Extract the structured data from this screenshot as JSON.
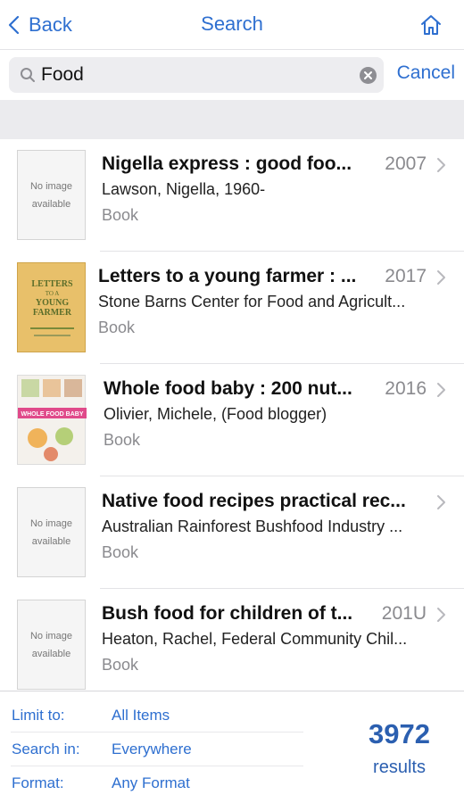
{
  "nav": {
    "back_label": "Back",
    "title": "Search",
    "home_icon": "home-icon"
  },
  "search": {
    "value": "Food",
    "placeholder": "",
    "cancel_label": "Cancel"
  },
  "results": [
    {
      "title": "Nigella express : good foo...",
      "year": "2007",
      "author": "Lawson, Nigella, 1960-",
      "format": "Book",
      "cover": "No image available"
    },
    {
      "title": "Letters to a young farmer : ...",
      "year": "2017",
      "author": "Stone Barns Center for Food and Agricult...",
      "format": "Book",
      "cover_lines": [
        "LETTERS",
        "TO A",
        "YOUNG",
        "FARMER"
      ]
    },
    {
      "title": "Whole food baby : 200 nut...",
      "year": "2016",
      "author": "Olivier, Michele, (Food blogger)",
      "format": "Book",
      "cover_text": "WHOLE FOOD BABY"
    },
    {
      "title": "Native food recipes practical rec...",
      "year": "",
      "author": "Australian Rainforest Bushfood Industry ...",
      "format": "Book",
      "cover": "No image available"
    },
    {
      "title": "Bush food for children of t...",
      "year": "201U",
      "author": "Heaton, Rachel, Federal Community Chil...",
      "format": "Book",
      "cover": "No image available"
    }
  ],
  "filters": {
    "limit_label": "Limit to:",
    "limit_value": "All Items",
    "search_in_label": "Search in:",
    "search_in_value": "Everywhere",
    "format_label": "Format:",
    "format_value": "Any Format"
  },
  "summary": {
    "count": "3972",
    "label": "results"
  },
  "colors": {
    "accent": "#2e6fd0",
    "count": "#2b5fb0",
    "secondary_text": "#8a8a8e"
  }
}
